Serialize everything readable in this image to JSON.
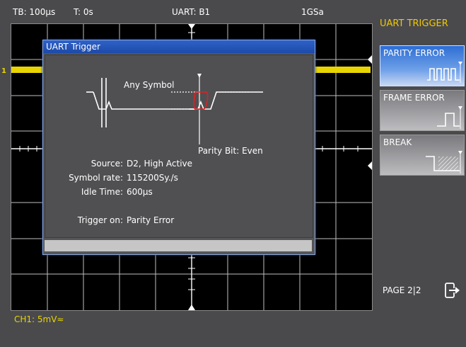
{
  "status_bar": {
    "timebase": "TB: 100µs",
    "trigger_time": "T: 0s",
    "bus": "UART: B1",
    "sample_rate": "1GSa"
  },
  "waveform": {
    "channel_marker": "1",
    "channel_label": "CH1: 5mV≈",
    "trace_color": "#e8d400"
  },
  "dialog": {
    "title": "UART Trigger",
    "diagram_any_symbol": "Any Symbol",
    "diagram_parity_bit": "Parity Bit: Even",
    "source_label": "Source:",
    "source_value": "D2, High Active",
    "symbol_rate_label": "Symbol rate:",
    "symbol_rate_value": "115200Sy./s",
    "idle_time_label": "Idle Time:",
    "idle_time_value": "600µs",
    "trigger_on_label": "Trigger on:",
    "trigger_on_value": "Parity Error"
  },
  "menu": {
    "title": "UART TRIGGER",
    "items": [
      {
        "label": "PARITY ERROR",
        "selected": true
      },
      {
        "label": "FRAME ERROR",
        "selected": false
      },
      {
        "label": "BREAK",
        "selected": false
      }
    ],
    "page": "PAGE 2|2"
  },
  "colors": {
    "accent_blue": "#2f62c9",
    "menu_title": "#f0c800",
    "parity_highlight": "#e02020"
  }
}
